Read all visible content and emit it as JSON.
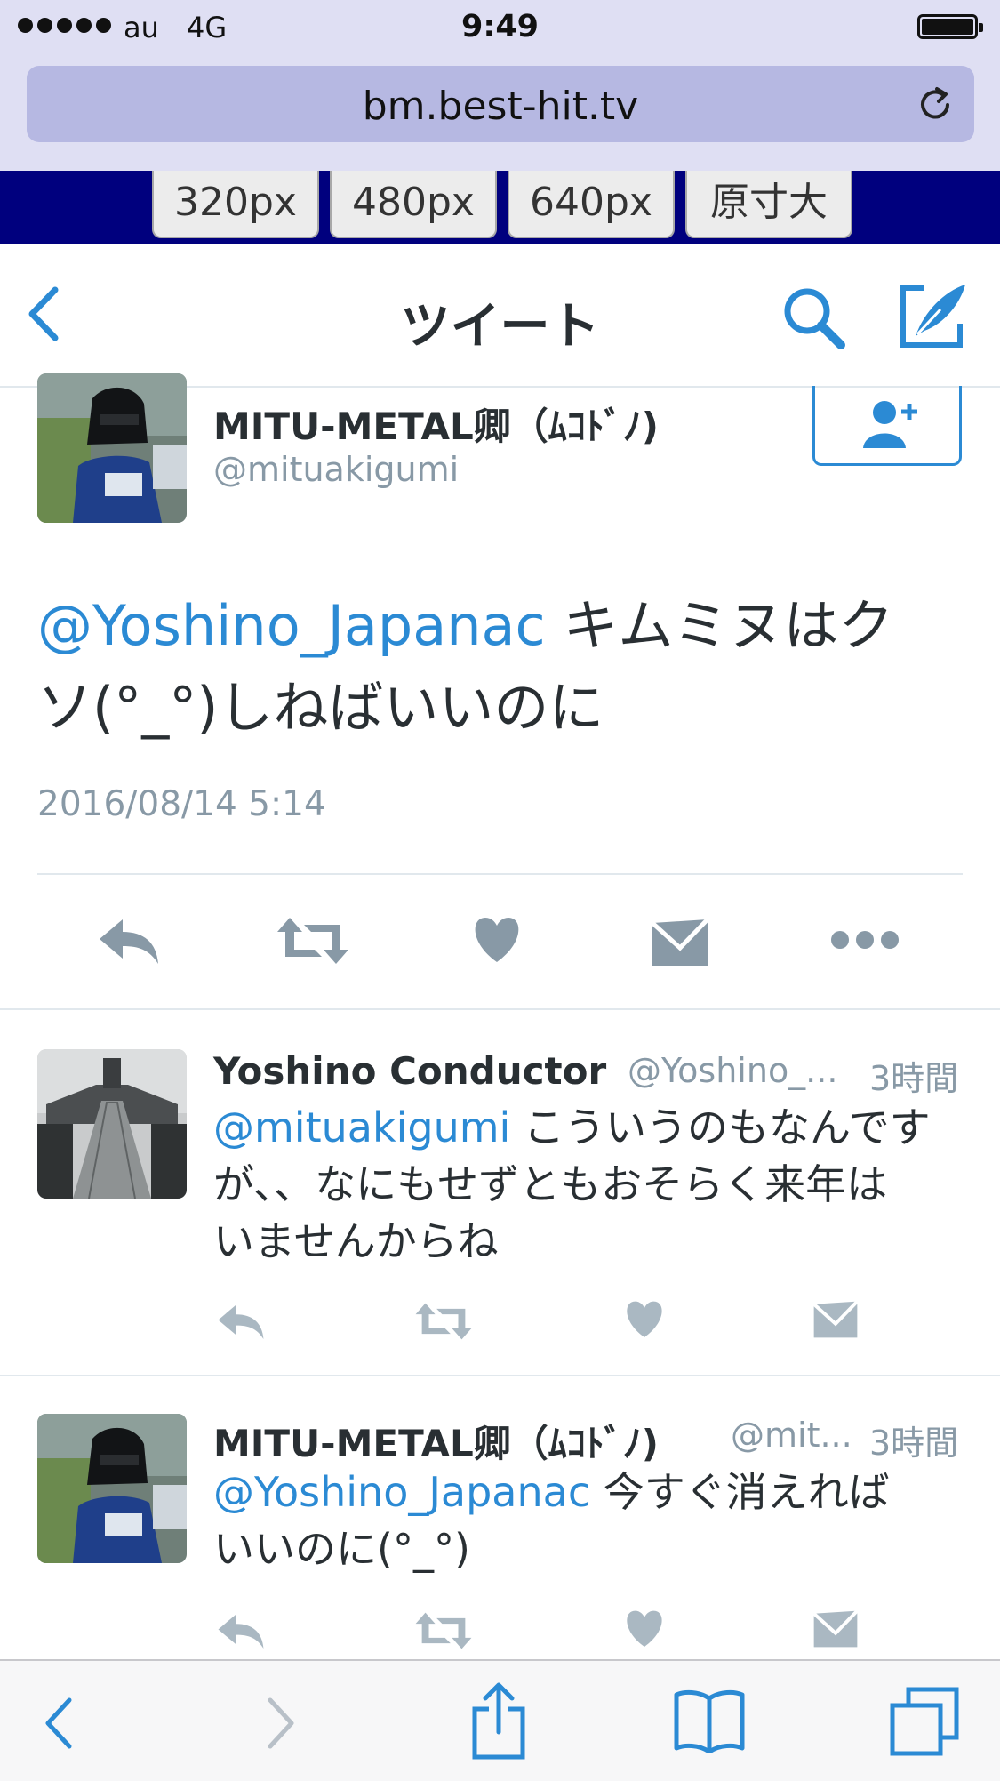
{
  "status_bar": {
    "carrier": "au",
    "network": "4G",
    "time": "9:49"
  },
  "browser": {
    "url": "bm.best-hit.tv"
  },
  "size_buttons": [
    "320px",
    "480px",
    "640px",
    "原寸大"
  ],
  "nav": {
    "title": "ツイート"
  },
  "main_tweet": {
    "name": "MITU-METAL卿（ﾑｺﾄﾞﾉ)",
    "handle": "@mituakigumi",
    "mention": "@Yoshino_Japanac",
    "text_line1_rest": " キムミヌはク",
    "text_line2": "ソ(°_°)しねばいいのに",
    "timestamp": "2016/08/14 5:14"
  },
  "replies": [
    {
      "name": "Yoshino Conductor",
      "handle": "@Yoshino_...",
      "time": "3時間",
      "mention": "@mituakigumi",
      "line1_rest": " こういうのもなんです",
      "line2": "が、、なにもせずともおそらく来年は",
      "line3": "いませんからね"
    },
    {
      "name": "MITU-METAL卿（ﾑｺﾄﾞﾉ)",
      "handle": "@mit...",
      "time": "3時間",
      "mention": "@Yoshino_Japanac",
      "line1_rest": " 今すぐ消えれば",
      "line2": "いいのに(°_°)"
    }
  ],
  "colors": {
    "accent": "#2b8ad4",
    "action_gray": "#8899a6",
    "browser_chrome": "#dfdff3",
    "size_band": "#00007e"
  },
  "icons": [
    "back-chevron-icon",
    "search-icon",
    "compose-icon",
    "follow-user-icon",
    "reply-icon",
    "retweet-icon",
    "like-icon",
    "dm-icon",
    "more-icon",
    "reload-icon",
    "share-icon",
    "bookmarks-icon",
    "tabs-icon"
  ]
}
